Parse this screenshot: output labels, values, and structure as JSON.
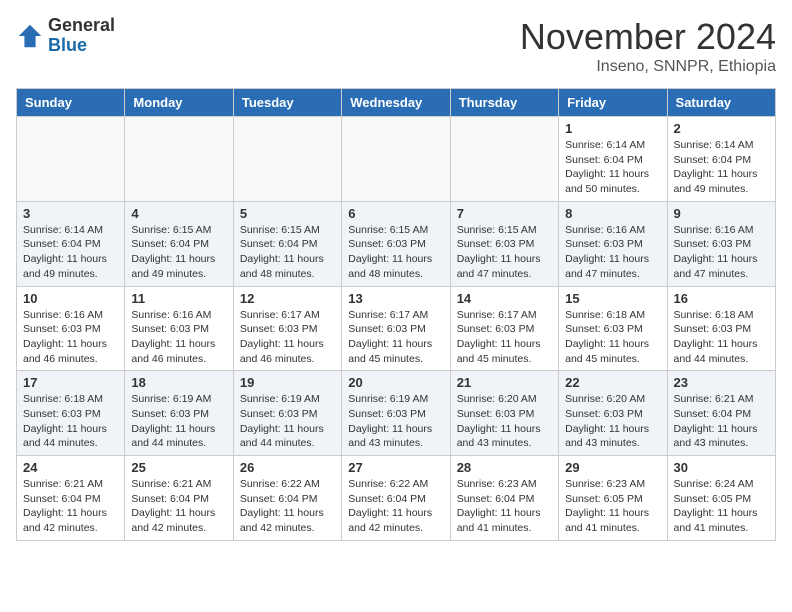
{
  "header": {
    "logo_general": "General",
    "logo_blue": "Blue",
    "month_title": "November 2024",
    "location": "Inseno, SNNPR, Ethiopia"
  },
  "weekdays": [
    "Sunday",
    "Monday",
    "Tuesday",
    "Wednesday",
    "Thursday",
    "Friday",
    "Saturday"
  ],
  "weeks": [
    [
      {
        "day": "",
        "info": ""
      },
      {
        "day": "",
        "info": ""
      },
      {
        "day": "",
        "info": ""
      },
      {
        "day": "",
        "info": ""
      },
      {
        "day": "",
        "info": ""
      },
      {
        "day": "1",
        "info": "Sunrise: 6:14 AM\nSunset: 6:04 PM\nDaylight: 11 hours\nand 50 minutes."
      },
      {
        "day": "2",
        "info": "Sunrise: 6:14 AM\nSunset: 6:04 PM\nDaylight: 11 hours\nand 49 minutes."
      }
    ],
    [
      {
        "day": "3",
        "info": "Sunrise: 6:14 AM\nSunset: 6:04 PM\nDaylight: 11 hours\nand 49 minutes."
      },
      {
        "day": "4",
        "info": "Sunrise: 6:15 AM\nSunset: 6:04 PM\nDaylight: 11 hours\nand 49 minutes."
      },
      {
        "day": "5",
        "info": "Sunrise: 6:15 AM\nSunset: 6:04 PM\nDaylight: 11 hours\nand 48 minutes."
      },
      {
        "day": "6",
        "info": "Sunrise: 6:15 AM\nSunset: 6:03 PM\nDaylight: 11 hours\nand 48 minutes."
      },
      {
        "day": "7",
        "info": "Sunrise: 6:15 AM\nSunset: 6:03 PM\nDaylight: 11 hours\nand 47 minutes."
      },
      {
        "day": "8",
        "info": "Sunrise: 6:16 AM\nSunset: 6:03 PM\nDaylight: 11 hours\nand 47 minutes."
      },
      {
        "day": "9",
        "info": "Sunrise: 6:16 AM\nSunset: 6:03 PM\nDaylight: 11 hours\nand 47 minutes."
      }
    ],
    [
      {
        "day": "10",
        "info": "Sunrise: 6:16 AM\nSunset: 6:03 PM\nDaylight: 11 hours\nand 46 minutes."
      },
      {
        "day": "11",
        "info": "Sunrise: 6:16 AM\nSunset: 6:03 PM\nDaylight: 11 hours\nand 46 minutes."
      },
      {
        "day": "12",
        "info": "Sunrise: 6:17 AM\nSunset: 6:03 PM\nDaylight: 11 hours\nand 46 minutes."
      },
      {
        "day": "13",
        "info": "Sunrise: 6:17 AM\nSunset: 6:03 PM\nDaylight: 11 hours\nand 45 minutes."
      },
      {
        "day": "14",
        "info": "Sunrise: 6:17 AM\nSunset: 6:03 PM\nDaylight: 11 hours\nand 45 minutes."
      },
      {
        "day": "15",
        "info": "Sunrise: 6:18 AM\nSunset: 6:03 PM\nDaylight: 11 hours\nand 45 minutes."
      },
      {
        "day": "16",
        "info": "Sunrise: 6:18 AM\nSunset: 6:03 PM\nDaylight: 11 hours\nand 44 minutes."
      }
    ],
    [
      {
        "day": "17",
        "info": "Sunrise: 6:18 AM\nSunset: 6:03 PM\nDaylight: 11 hours\nand 44 minutes."
      },
      {
        "day": "18",
        "info": "Sunrise: 6:19 AM\nSunset: 6:03 PM\nDaylight: 11 hours\nand 44 minutes."
      },
      {
        "day": "19",
        "info": "Sunrise: 6:19 AM\nSunset: 6:03 PM\nDaylight: 11 hours\nand 44 minutes."
      },
      {
        "day": "20",
        "info": "Sunrise: 6:19 AM\nSunset: 6:03 PM\nDaylight: 11 hours\nand 43 minutes."
      },
      {
        "day": "21",
        "info": "Sunrise: 6:20 AM\nSunset: 6:03 PM\nDaylight: 11 hours\nand 43 minutes."
      },
      {
        "day": "22",
        "info": "Sunrise: 6:20 AM\nSunset: 6:03 PM\nDaylight: 11 hours\nand 43 minutes."
      },
      {
        "day": "23",
        "info": "Sunrise: 6:21 AM\nSunset: 6:04 PM\nDaylight: 11 hours\nand 43 minutes."
      }
    ],
    [
      {
        "day": "24",
        "info": "Sunrise: 6:21 AM\nSunset: 6:04 PM\nDaylight: 11 hours\nand 42 minutes."
      },
      {
        "day": "25",
        "info": "Sunrise: 6:21 AM\nSunset: 6:04 PM\nDaylight: 11 hours\nand 42 minutes."
      },
      {
        "day": "26",
        "info": "Sunrise: 6:22 AM\nSunset: 6:04 PM\nDaylight: 11 hours\nand 42 minutes."
      },
      {
        "day": "27",
        "info": "Sunrise: 6:22 AM\nSunset: 6:04 PM\nDaylight: 11 hours\nand 42 minutes."
      },
      {
        "day": "28",
        "info": "Sunrise: 6:23 AM\nSunset: 6:04 PM\nDaylight: 11 hours\nand 41 minutes."
      },
      {
        "day": "29",
        "info": "Sunrise: 6:23 AM\nSunset: 6:05 PM\nDaylight: 11 hours\nand 41 minutes."
      },
      {
        "day": "30",
        "info": "Sunrise: 6:24 AM\nSunset: 6:05 PM\nDaylight: 11 hours\nand 41 minutes."
      }
    ]
  ]
}
